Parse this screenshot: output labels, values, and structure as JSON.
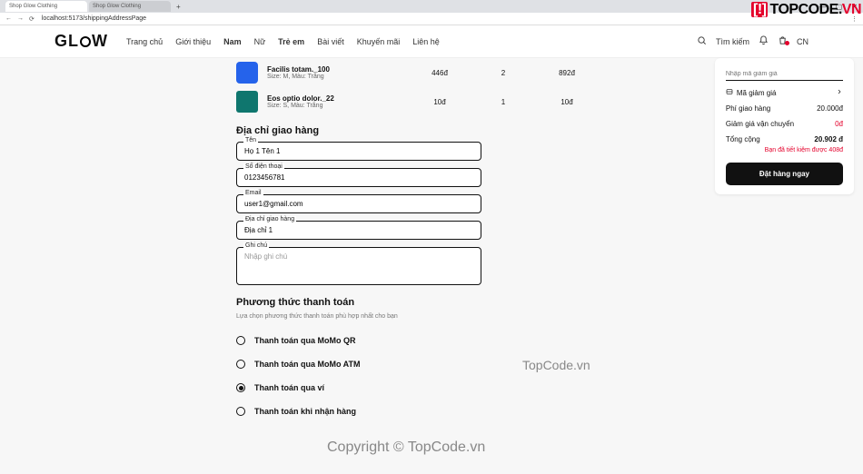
{
  "browser": {
    "tab1": "Shop Glow Clothing",
    "tab2": "Shop Glow Clothing",
    "url": "localhost:5173/shippingAddressPage",
    "back": "←",
    "fwd": "→",
    "reload": "⟳",
    "min": "—",
    "max": "▢",
    "close": "✕",
    "more": "⋮"
  },
  "topcode": {
    "bracket": "[!]",
    "text": "TOPCODE",
    "dot": ".",
    "vn": "VN"
  },
  "watermark1": "TopCode.vn",
  "watermark2": "Copyright © TopCode.vn",
  "header": {
    "logo_left": "GL",
    "logo_right": "W",
    "nav": {
      "home": "Trang chủ",
      "about": "Giới thiệu",
      "men": "Nam",
      "women": "Nữ",
      "kids": "Trẻ em",
      "blog": "Bài viết",
      "promo": "Khuyến mãi",
      "contact": "Liên hệ"
    },
    "search": "Tìm kiếm",
    "cn": "CN"
  },
  "cart": [
    {
      "name": "Facilis totam._100",
      "variant": "Size: M, Màu: Trắng",
      "price": "446đ",
      "qty": "2",
      "total": "892đ",
      "thumb": "blue"
    },
    {
      "name": "Eos optio dolor._22",
      "variant": "Size: S, Màu: Trắng",
      "price": "10đ",
      "qty": "1",
      "total": "10đ",
      "thumb": "teal"
    }
  ],
  "shipping": {
    "title": "Địa chỉ giao hàng",
    "name_label": "Tên",
    "name_val": "Họ 1 Tên 1",
    "phone_label": "Số điện thoại",
    "phone_val": "0123456781",
    "email_label": "Email",
    "email_val": "user1@gmail.com",
    "addr_label": "Địa chỉ giao hàng",
    "addr_val": "Địa chỉ 1",
    "note_label": "Ghi chú",
    "note_placeholder": "Nhập ghi chú"
  },
  "payment": {
    "title": "Phương thức thanh toán",
    "sub": "Lựa chọn phương thức thanh toán phù hợp nhất cho bạn",
    "opts": [
      {
        "label": "Thanh toán qua MoMo QR",
        "sel": false
      },
      {
        "label": "Thanh toán qua MoMo ATM",
        "sel": false
      },
      {
        "label": "Thanh toán qua ví",
        "sel": true
      },
      {
        "label": "Thanh toán khi nhận hàng",
        "sel": false
      }
    ]
  },
  "summary": {
    "promo_placeholder": "Nhập mã giảm giá",
    "promo_label": "Mã giảm giá",
    "ship_label": "Phí giao hàng",
    "ship_val": "20.000đ",
    "disc_label": "Giảm giá vận chuyển",
    "disc_val": "0đ",
    "total_label": "Tổng cộng",
    "total_val": "20.902 đ",
    "save": "Bạn đã tiết kiệm được 408đ",
    "btn": "Đặt hàng ngay"
  }
}
